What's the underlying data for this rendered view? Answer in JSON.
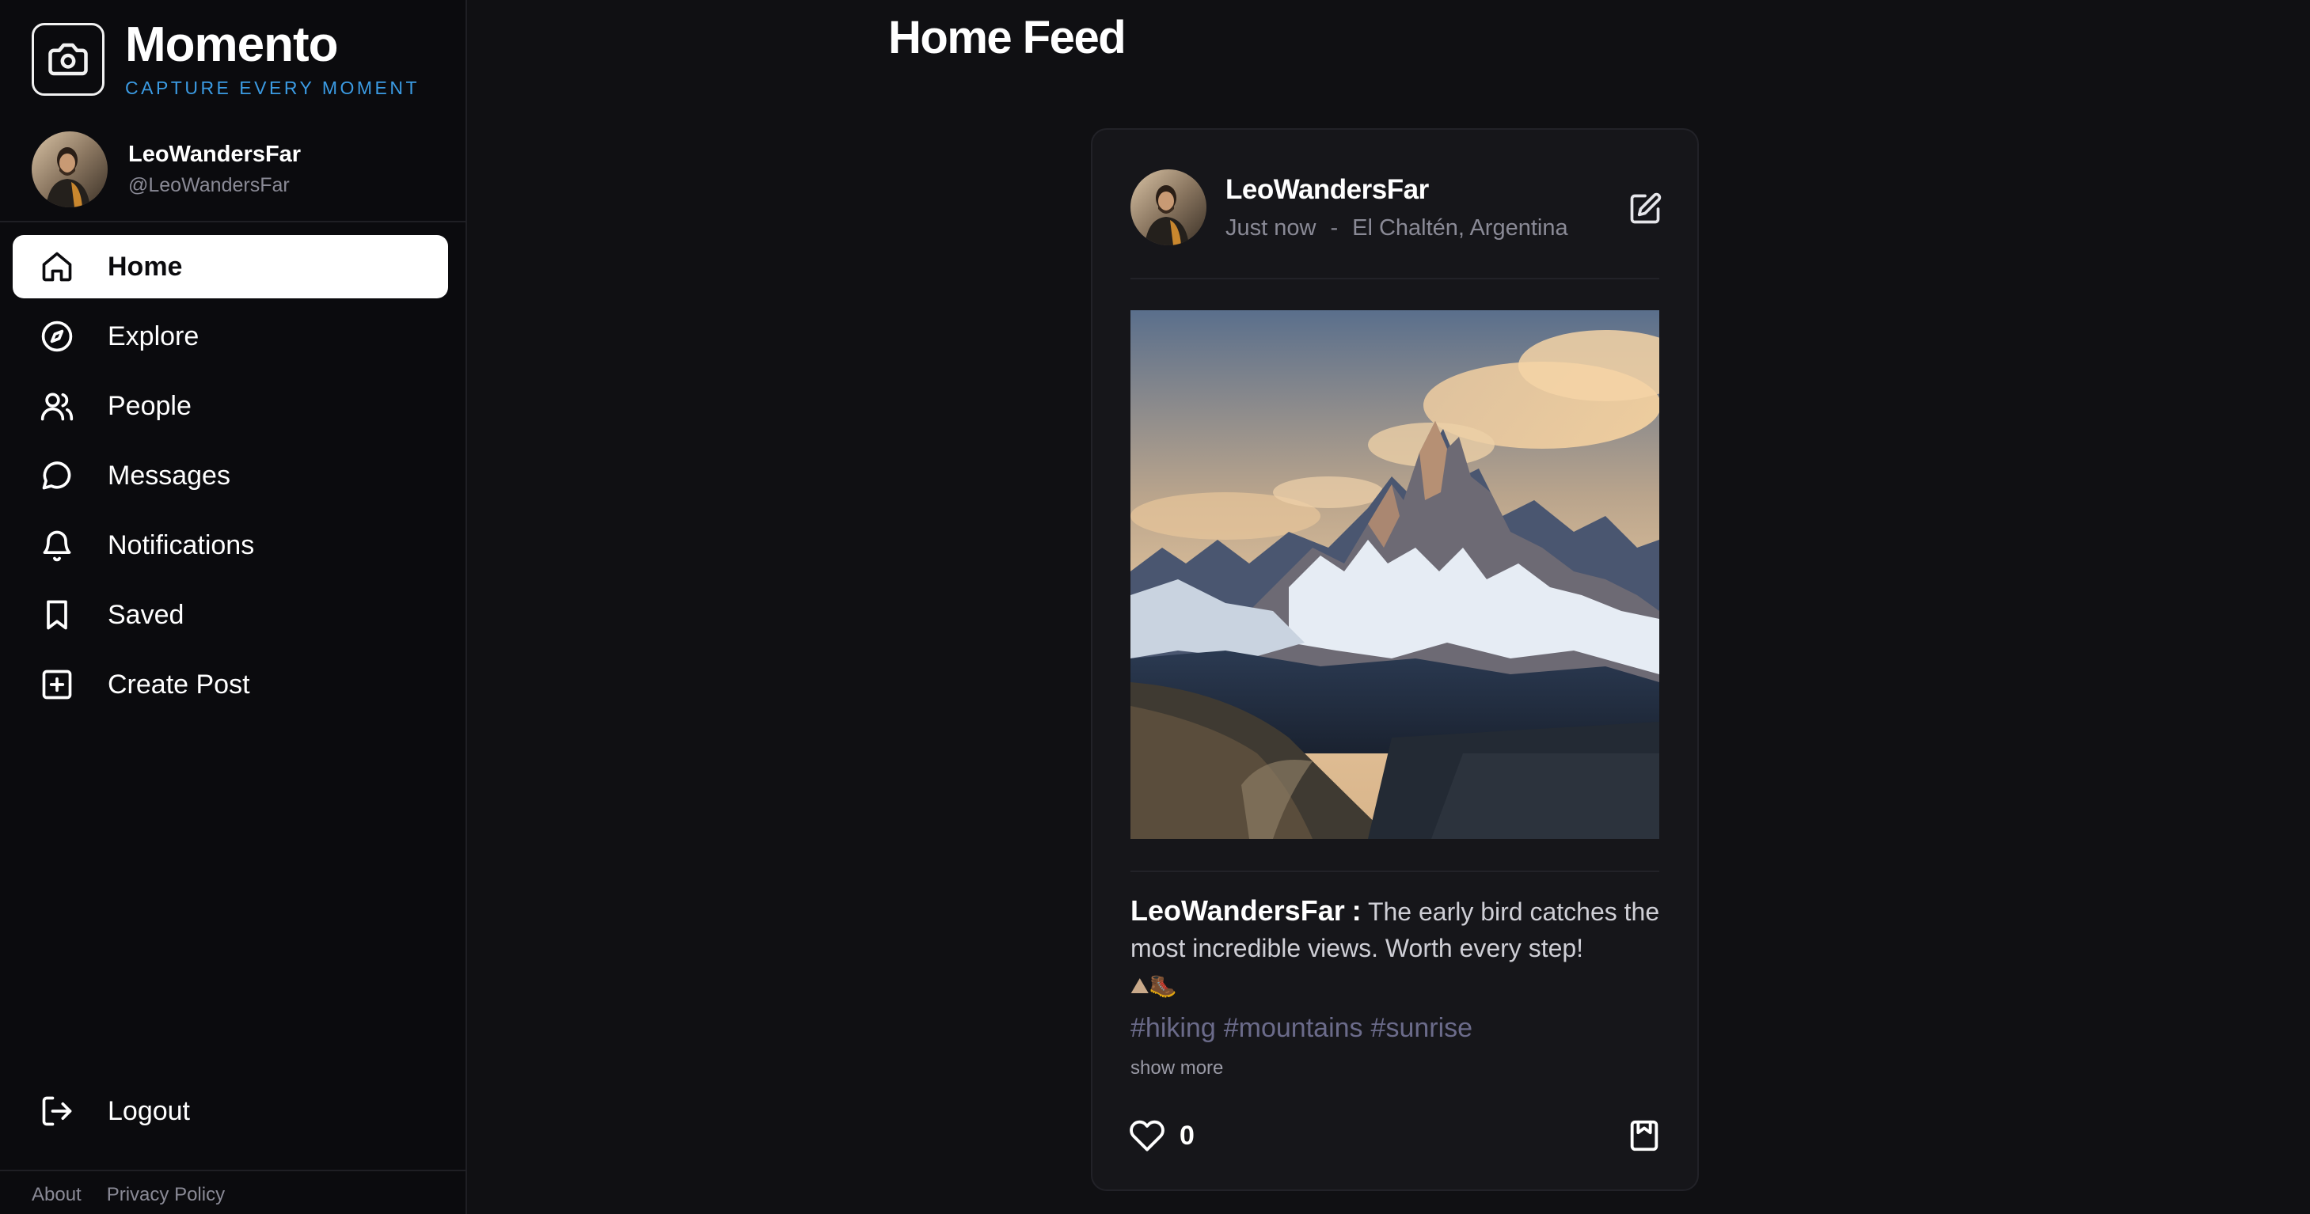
{
  "brand": {
    "name": "Momento",
    "tagline": "CAPTURE EVERY MOMENT"
  },
  "profile": {
    "name": "LeoWandersFar",
    "handle": "@LeoWandersFar"
  },
  "nav": {
    "items": [
      {
        "label": "Home",
        "icon": "home-icon",
        "active": true
      },
      {
        "label": "Explore",
        "icon": "compass-icon"
      },
      {
        "label": "People",
        "icon": "people-icon"
      },
      {
        "label": "Messages",
        "icon": "message-icon"
      },
      {
        "label": "Notifications",
        "icon": "bell-icon"
      },
      {
        "label": "Saved",
        "icon": "bookmark-icon"
      },
      {
        "label": "Create Post",
        "icon": "plus-square-icon"
      }
    ],
    "logout": "Logout"
  },
  "footer": {
    "about": "About",
    "privacy": "Privacy Policy"
  },
  "page": {
    "title": "Home Feed"
  },
  "post": {
    "username": "LeoWandersFar",
    "time": "Just now",
    "separator": "-",
    "location": "El Chaltén, Argentina",
    "caption_user": "LeoWandersFar",
    "caption_colon": ":",
    "caption_text": "The early bird catches the most incredible views. Worth every step!",
    "caption_emoji": "⛰🥾",
    "tags": [
      "#hiking",
      "#mountains",
      "#sunrise"
    ],
    "show_more": "show more",
    "likes": "0"
  },
  "colors": {
    "background": "#101013",
    "sidebar": "#0b0b0e",
    "card": "#16161a",
    "accent": "#3b9be3",
    "tag": "#6b6b8a"
  }
}
